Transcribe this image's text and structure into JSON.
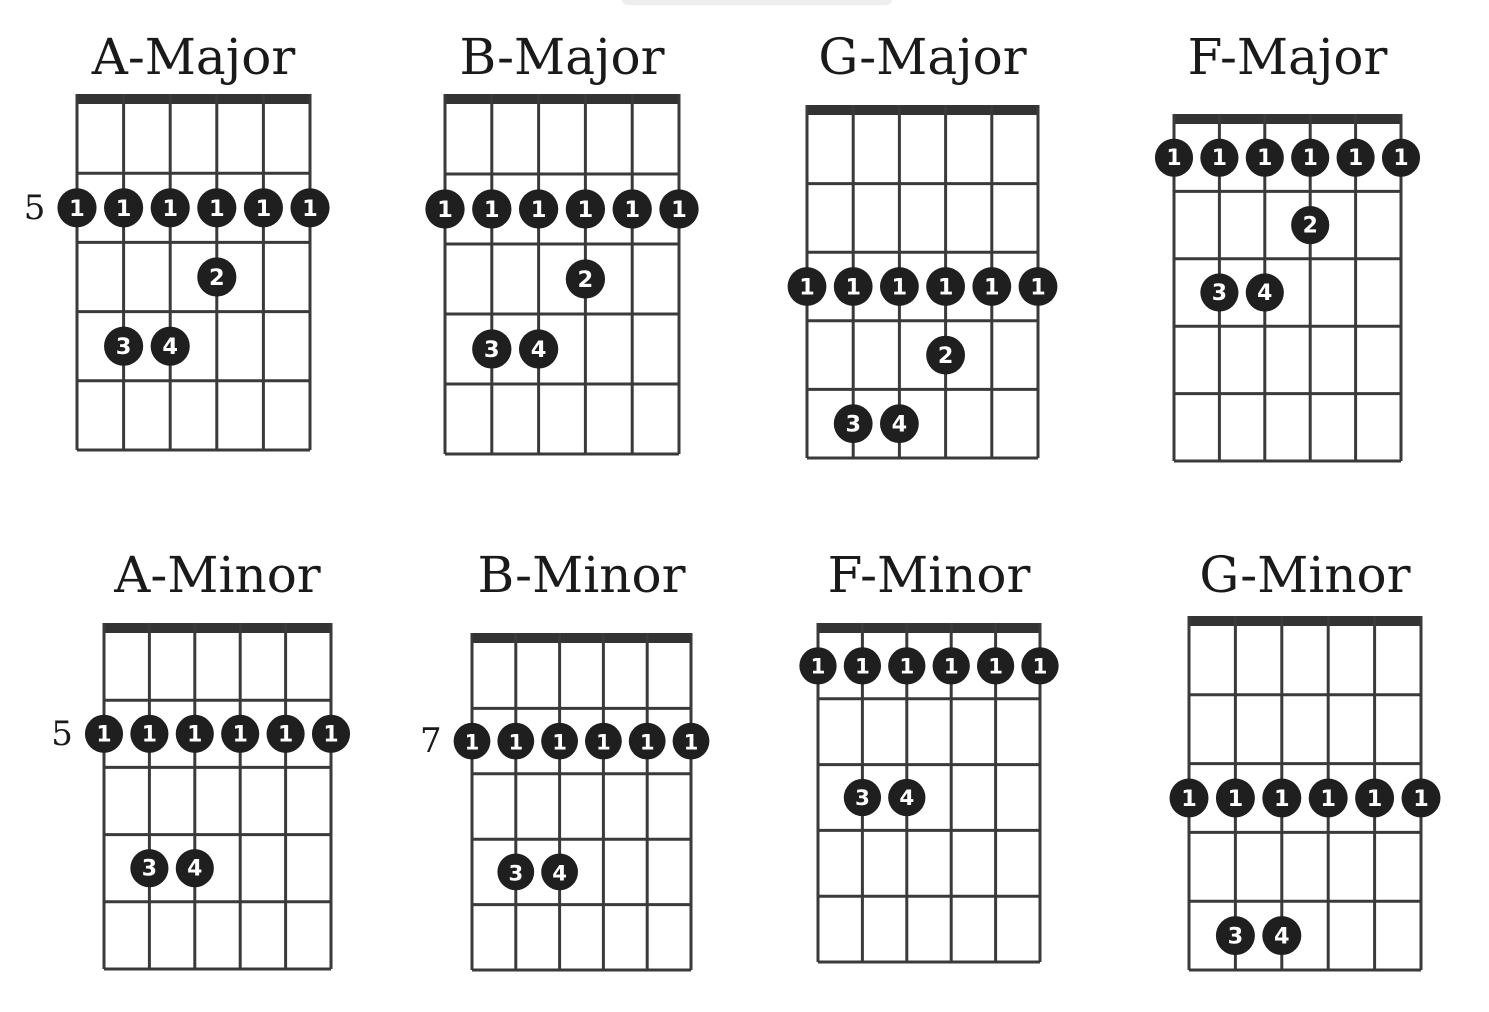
{
  "chords": [
    {
      "name": "A-Major",
      "fret_label": "5",
      "rows": [
        {
          "fret": 2,
          "fingers": [
            "1",
            "1",
            "1",
            "1",
            "1",
            "1"
          ]
        },
        {
          "fret": 3,
          "fingers": [
            "",
            "",
            "",
            "2",
            "",
            ""
          ]
        },
        {
          "fret": 4,
          "fingers": [
            "",
            "3",
            "4",
            "",
            "",
            ""
          ]
        }
      ]
    },
    {
      "name": "B-Major",
      "fret_label": "",
      "rows": [
        {
          "fret": 2,
          "fingers": [
            "1",
            "1",
            "1",
            "1",
            "1",
            "1"
          ]
        },
        {
          "fret": 3,
          "fingers": [
            "",
            "",
            "",
            "2",
            "",
            ""
          ]
        },
        {
          "fret": 4,
          "fingers": [
            "",
            "3",
            "4",
            "",
            "",
            ""
          ]
        }
      ]
    },
    {
      "name": "G-Major",
      "fret_label": "",
      "rows": [
        {
          "fret": 3,
          "fingers": [
            "1",
            "1",
            "1",
            "1",
            "1",
            "1"
          ]
        },
        {
          "fret": 4,
          "fingers": [
            "",
            "",
            "",
            "2",
            "",
            ""
          ]
        },
        {
          "fret": 5,
          "fingers": [
            "",
            "3",
            "4",
            "",
            "",
            ""
          ]
        }
      ]
    },
    {
      "name": "F-Major",
      "fret_label": "",
      "rows": [
        {
          "fret": 1,
          "fingers": [
            "1",
            "1",
            "1",
            "1",
            "1",
            "1"
          ]
        },
        {
          "fret": 2,
          "fingers": [
            "",
            "",
            "",
            "2",
            "",
            ""
          ]
        },
        {
          "fret": 3,
          "fingers": [
            "",
            "3",
            "4",
            "",
            "",
            ""
          ]
        }
      ]
    },
    {
      "name": "A-Minor",
      "fret_label": "5",
      "rows": [
        {
          "fret": 2,
          "fingers": [
            "1",
            "1",
            "1",
            "1",
            "1",
            "1"
          ]
        },
        {
          "fret": 4,
          "fingers": [
            "",
            "3",
            "4",
            "",
            "",
            ""
          ]
        }
      ]
    },
    {
      "name": "B-Minor",
      "fret_label": "7",
      "rows": [
        {
          "fret": 2,
          "fingers": [
            "1",
            "1",
            "1",
            "1",
            "1",
            "1"
          ]
        },
        {
          "fret": 4,
          "fingers": [
            "",
            "3",
            "4",
            "",
            "",
            ""
          ]
        }
      ]
    },
    {
      "name": "F-Minor",
      "fret_label": "",
      "rows": [
        {
          "fret": 1,
          "fingers": [
            "1",
            "1",
            "1",
            "1",
            "1",
            "1"
          ]
        },
        {
          "fret": 3,
          "fingers": [
            "",
            "3",
            "4",
            "",
            "",
            ""
          ]
        }
      ]
    },
    {
      "name": "G-Minor",
      "fret_label": "",
      "rows": [
        {
          "fret": 3,
          "fingers": [
            "1",
            "1",
            "1",
            "1",
            "1",
            "1"
          ]
        },
        {
          "fret": 5,
          "fingers": [
            "",
            "3",
            "4",
            "",
            "",
            ""
          ]
        }
      ]
    }
  ],
  "colors": {
    "grid": "#3a3a3a",
    "nut": "#333333",
    "dot": "#1f1f1f",
    "dot_text": "#ffffff",
    "title": "#1a1a1a"
  }
}
